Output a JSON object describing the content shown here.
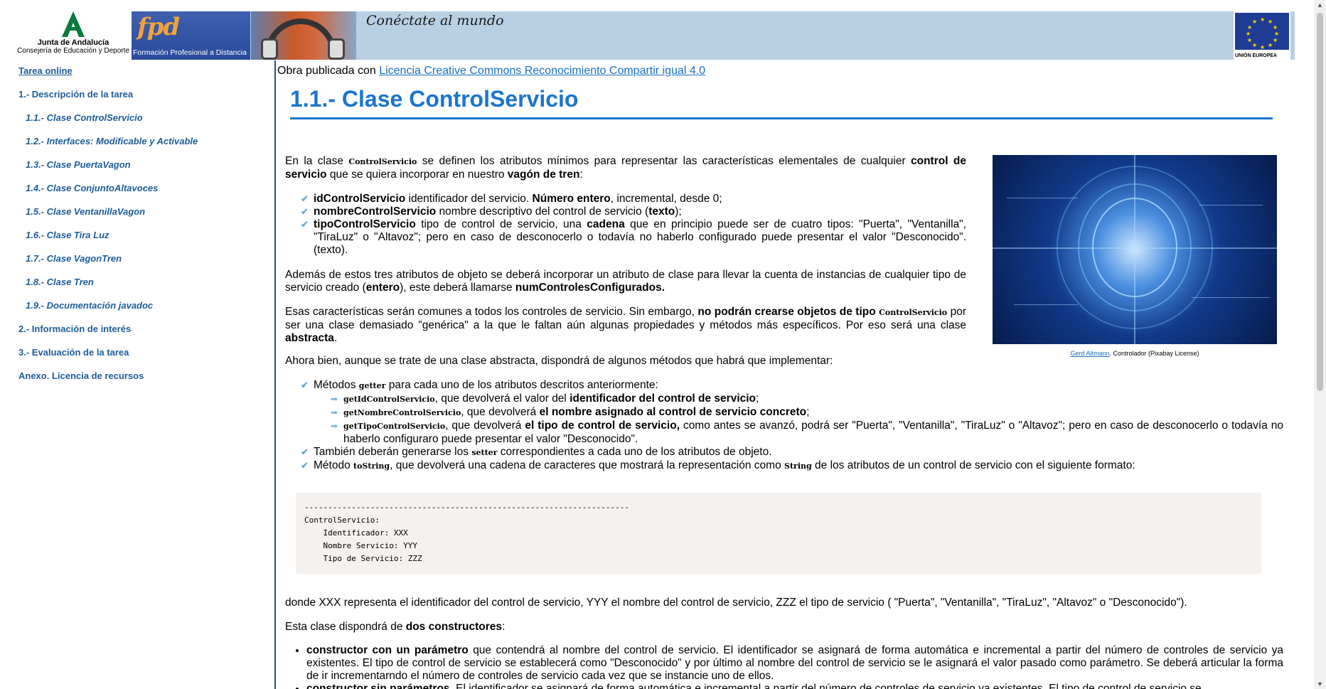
{
  "header": {
    "junta_name": "Junta de Andalucía",
    "junta_sub": "Consejería de Educación y Deporte",
    "fpd_logo": "fpd",
    "fpd_text": "Formación Profesional a Distancia",
    "slogan": "Conéctate al mundo",
    "eu_text": "UNIÓN EUROPEA"
  },
  "sidebar": {
    "top_link": "Tarea online",
    "items": [
      {
        "label": "1.- Descripción de la tarea",
        "level": "main"
      },
      {
        "label": "1.1.- Clase ControlServicio",
        "level": "sub"
      },
      {
        "label": "1.2.- Interfaces: Modificable y Activable",
        "level": "sub"
      },
      {
        "label": "1.3.- Clase PuertaVagon",
        "level": "sub"
      },
      {
        "label": "1.4.- Clase ConjuntoAltavoces",
        "level": "sub"
      },
      {
        "label": "1.5.- Clase VentanillaVagon",
        "level": "sub"
      },
      {
        "label": "1.6.- Clase Tira Luz",
        "level": "sub"
      },
      {
        "label": "1.7.- Clase VagonTren",
        "level": "sub"
      },
      {
        "label": "1.8.- Clase Tren",
        "level": "sub"
      },
      {
        "label": "1.9.- Documentación javadoc",
        "level": "sub"
      },
      {
        "label": "2.- Información de interés",
        "level": "main"
      },
      {
        "label": "3.- Evaluación de la tarea",
        "level": "main"
      },
      {
        "label": "Anexo. Licencia de recursos",
        "level": "main"
      }
    ]
  },
  "main": {
    "license_prefix": "Obra publicada con ",
    "license_link": "Licencia Creative Commons Reconocimiento Compartir igual 4.0",
    "title": "1.1.- Clase ControlServicio",
    "intro": {
      "t1": "En la clase ",
      "c1": "ControlServicio",
      "t2": " se definen los atributos mínimos para representar las características elementales de cualquier ",
      "b1": "control de servicio",
      "t3": " que se quiera  incorporar en nuestro ",
      "b2": "vagón de tren",
      "t4": ":"
    },
    "attributes": [
      {
        "name": "idControlServicio",
        "t1": " identificador del servicio. ",
        "b": "Número entero",
        "t2": ", incremental, desde 0;"
      },
      {
        "name": "nombreControlServicio",
        "t1": " nombre descriptivo del control de servicio (",
        "b": "texto",
        "t2": ");"
      },
      {
        "name": "tipoControlServicio",
        "t1": " tipo de control de servicio, una ",
        "b": "cadena",
        "t2": " que en principio puede ser de cuatro tipos: \"Puerta\", \"Ventanilla\", \"TiraLuz\" o \"Altavoz\"; pero en caso de desconocerlo o todavía no haberlo configurado puede presentar el valor \"Desconocido\". (texto)."
      }
    ],
    "p_static": {
      "t1": "Además de estos tres atributos de objeto se deberá incorporar un atributo de clase para llevar la cuenta de instancias de cualquier tipo de servicio creado (",
      "b1": "entero",
      "t2": "), este deberá llamarse ",
      "b2": "numControlesConfigurados."
    },
    "p_common": {
      "t1": "Esas características serán comunes a todos los controles de servicio. Sin embargo, ",
      "b1": "no podrán crearse objetos de tipo ",
      "c1": "ControlServicio",
      "t2": " por ser una clase demasiado \"genérica\" a la que le faltan aún algunas propiedades y métodos más específicos. Por eso será una clase ",
      "b2": "abstracta",
      "t3": "."
    },
    "p_methods": "Ahora bien, aunque se trate de una clase abstracta, dispondrá de algunos métodos que habrá que implementar:",
    "methods": {
      "getter_t1": "Métodos ",
      "getter_c": "getter",
      "getter_t2": " para cada uno de los atributos descritos anteriormente:",
      "getters": [
        {
          "c": "getIdControlServicio",
          "t1": ", que devolverá el valor del ",
          "b": "identificador del control de servicio",
          "t2": ";"
        },
        {
          "c": "getNombreControlServicio",
          "t1": ",  que  devolverá ",
          "b": "el nombre asignado al control de servicio concreto",
          "t2": ";"
        },
        {
          "c": "getTipoControlServicio",
          "t1": ", que devolverá ",
          "b": "el tipo de control de servicio,",
          "t2": " como antes se avanzó, podrá ser \"Puerta\", \"Ventanilla\", \"TiraLuz\" o \"Altavoz\"; pero en caso de desconocerlo o todavía no haberlo configuraro puede presentar el valor \"Desconocido\"."
        }
      ],
      "setter_t1": "También deberán generarse los ",
      "setter_c": "setter",
      "setter_t2": " correspondientes a cada uno de los atributos de objeto.",
      "tostring_t1": "Método ",
      "tostring_c": "toString",
      "tostring_t2": ", que devolverá una cadena de caracteres que mostrará la representación como ",
      "tostring_c2": "String",
      "tostring_t3": " de los atributos de un control de servicio con el siguiente formato:"
    },
    "code": "---------------------------------------------------------------------\nControlServicio:\n    Identificador: XXX\n    Nombre Servicio: YYY\n    Tipo de Servicio: ZZZ",
    "p_where": "donde XXX representa el identificador del control de servicio, YYY el nombre del control de servicio, ZZZ el tipo de servicio ( \"Puerta\", \"Ventanilla\", \"TiraLuz\", \"Altavoz\" o  \"Desconocido\").",
    "p_constructors": {
      "t1": "Esta clase dispondrá de ",
      "b1": "dos constructores",
      "t2": ":"
    },
    "constructors": [
      {
        "b": "constructor con un parámetro",
        "t": " que contendrá  al nombre del control de servicio. El identificador se asignará de forma automática e incremental a partir del número de controles de servicio ya existentes. El tipo de control de servicio se establecerá como \"Desconocido\" y por último al nombre del control de servicio se le asignará el valor pasado como parámetro. Se deberá articular la forma de ir incrementarndo el número de controles de servicio cada vez que se instancie uno de ellos."
      },
      {
        "b": "constructor sin parámetros",
        "t": ". El identificador se asignará de forma automática e incremental a partir del número de controles de servicio ya existentes. El tipo de control de servicio se"
      }
    ],
    "figure_caption_link": "Gerd Altmann",
    "figure_caption_text": ". Controlador (Pixabay License)"
  },
  "colors": {
    "link": "#1d5c99",
    "title": "#1a75cf",
    "check": "#74a9c9",
    "code_bg": "#f4f1ee"
  },
  "icons": [
    "check-icon",
    "arrow-bullet-icon",
    "junta-logo-icon",
    "eu-flag-icon"
  ]
}
